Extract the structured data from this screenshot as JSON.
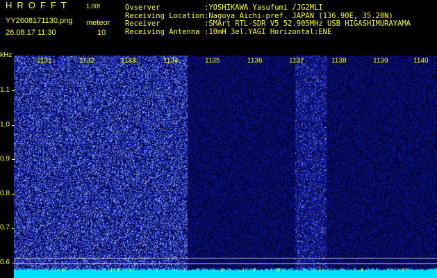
{
  "header": {
    "app_title": "HROFFT",
    "app_version": "1.00f",
    "filename": "YY2608171130.png",
    "timestamp": "26.08.17 11:30",
    "meteor_label": "meteor",
    "meteor_count": "10"
  },
  "station_info": [
    {
      "key": "Ovserver",
      "value": ":YOSHIKAWA Yasufumi /JG2MLI"
    },
    {
      "key": "Receiving Location",
      "value": ":Nagoya Aichi-pref. JAPAN (136.90E, 35.20N)"
    },
    {
      "key": "Receiver",
      "value": ":SMArt RTL-SDR V5 52.905MHz USB HIGASHIMURAYAMA"
    },
    {
      "key": "Receiving Antenna",
      "value": ":10mH 3el.YAGI Horizontal:ENE"
    }
  ],
  "spectrogram": {
    "y_unit": "kHz",
    "y_labels": [
      "1.1",
      "1.0",
      "0.9",
      "0.8",
      "0.7",
      "0.6"
    ],
    "x_labels": [
      "1131",
      "1132",
      "1133",
      "1134",
      "1135",
      "1136",
      "1137",
      "1138",
      "1139",
      "1140"
    ],
    "colors": {
      "background": "#000033",
      "bright": "#4455ff",
      "baseline": "#00ffff",
      "gridline": "#ffffff"
    }
  }
}
